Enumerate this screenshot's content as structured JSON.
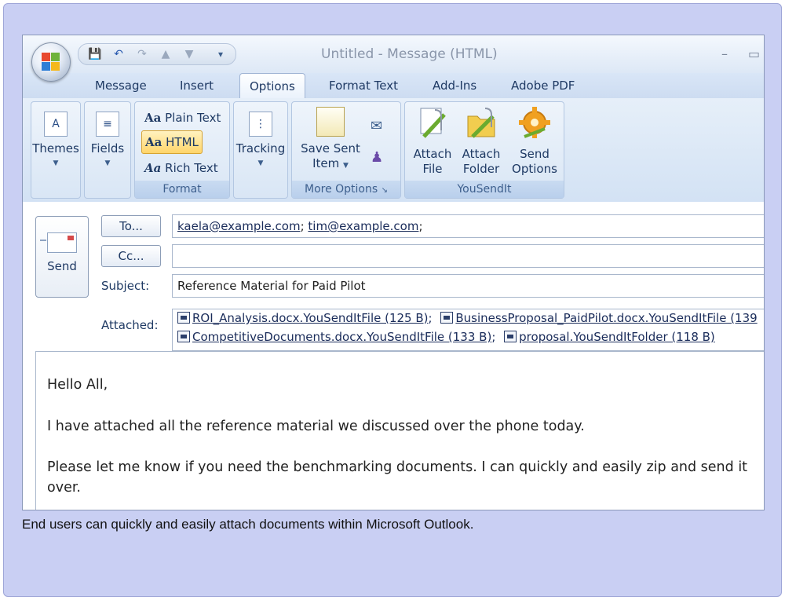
{
  "window": {
    "title": "Untitled - Message (HTML)"
  },
  "quick_access": [
    "save-icon",
    "undo-icon",
    "redo-icon",
    "up-icon",
    "down-icon",
    "customize-icon"
  ],
  "tabs": [
    {
      "label": "Message"
    },
    {
      "label": "Insert"
    },
    {
      "label": "Options"
    },
    {
      "label": "Format Text"
    },
    {
      "label": "Add-Ins"
    },
    {
      "label": "Adobe PDF"
    }
  ],
  "ribbon": {
    "themes_label": "Themes",
    "fields_label": "Fields",
    "format": {
      "plain": "Plain Text",
      "html": "HTML",
      "rich": "Rich Text",
      "group": "Format",
      "aa": "Aa"
    },
    "tracking_label": "Tracking",
    "more_options": {
      "save_sent_1": "Save Sent",
      "save_sent_2": "Item",
      "group": "More Options"
    },
    "yousendit": {
      "attach_file_1": "Attach",
      "attach_file_2": "File",
      "attach_folder_1": "Attach",
      "attach_folder_2": "Folder",
      "send_options_1": "Send",
      "send_options_2": "Options",
      "group": "YouSendIt"
    }
  },
  "compose": {
    "send_label": "Send",
    "to_button": "To...",
    "cc_button": "Cc...",
    "subject_label": "Subject:",
    "attached_label": "Attached:",
    "to_1": "kaela@example.com",
    "to_2": "tim@example.com",
    "sep": ";",
    "cc_value": "",
    "subject_value": "Reference Material for Paid Pilot",
    "attachments": [
      "ROI_Analysis.docx.YouSendItFile (125 B)",
      "BusinessProposal_PaidPilot.docx.YouSendItFile (139",
      "CompetitiveDocuments.docx.YouSendItFile (133 B)",
      "proposal.YouSendItFolder (118 B)"
    ]
  },
  "body": {
    "greeting": "Hello All,",
    "line1": "I have attached all the  reference material we discussed over the phone today.",
    "line2": "Please let me know if you need the benchmarking documents. I can quickly and easily zip and send it",
    "line3": "over."
  },
  "caption": "End users can quickly and easily attach documents within Microsoft Outlook."
}
